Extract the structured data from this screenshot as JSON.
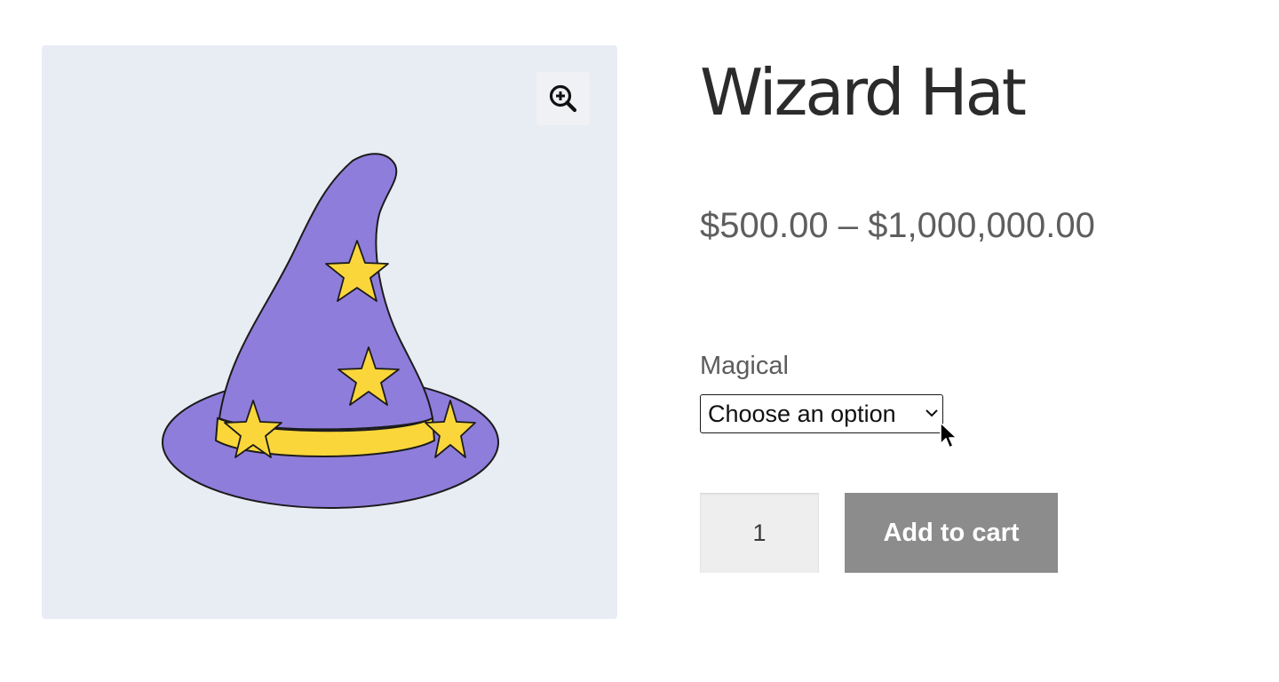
{
  "product": {
    "title": "Wizard Hat",
    "price_range": "$500.00 – $1,000,000.00"
  },
  "gallery": {
    "zoom_icon": "zoom-in-icon",
    "image_subject": "purple-wizard-hat-with-yellow-stars"
  },
  "variation": {
    "label": "Magical",
    "selected": "Choose an option"
  },
  "cart": {
    "quantity": "1",
    "add_label": "Add to cart"
  },
  "colors": {
    "gallery_bg": "#e8ecf3",
    "hat_purple": "#8f7ddb",
    "star_yellow": "#fad63a",
    "button_gray": "#8a8a8a",
    "title_text": "#2b2b2b",
    "price_text": "#5e5e5e"
  }
}
